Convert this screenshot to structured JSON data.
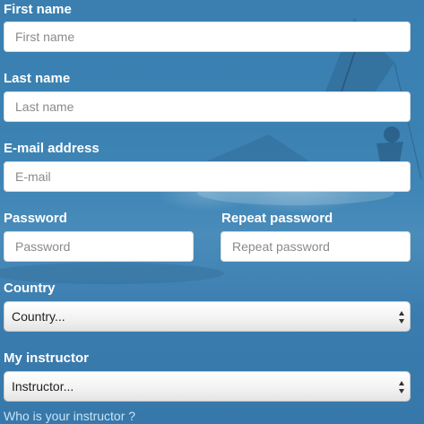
{
  "form": {
    "first_name": {
      "label": "First name",
      "placeholder": "First name"
    },
    "last_name": {
      "label": "Last name",
      "placeholder": "Last name"
    },
    "email": {
      "label": "E-mail address",
      "placeholder": "E-mail"
    },
    "password": {
      "label": "Password",
      "placeholder": "Password"
    },
    "repeat_password": {
      "label": "Repeat password",
      "placeholder": "Repeat password"
    },
    "country": {
      "label": "Country",
      "selected": "Country..."
    },
    "instructor": {
      "label": "My instructor",
      "selected": "Instructor..."
    },
    "instructor_help_link": "Who is your instructor ?"
  },
  "colors": {
    "background": "#3b82b3",
    "label_text": "#ffffff",
    "link_text": "#c9e3f3",
    "input_background": "#ffffff"
  }
}
